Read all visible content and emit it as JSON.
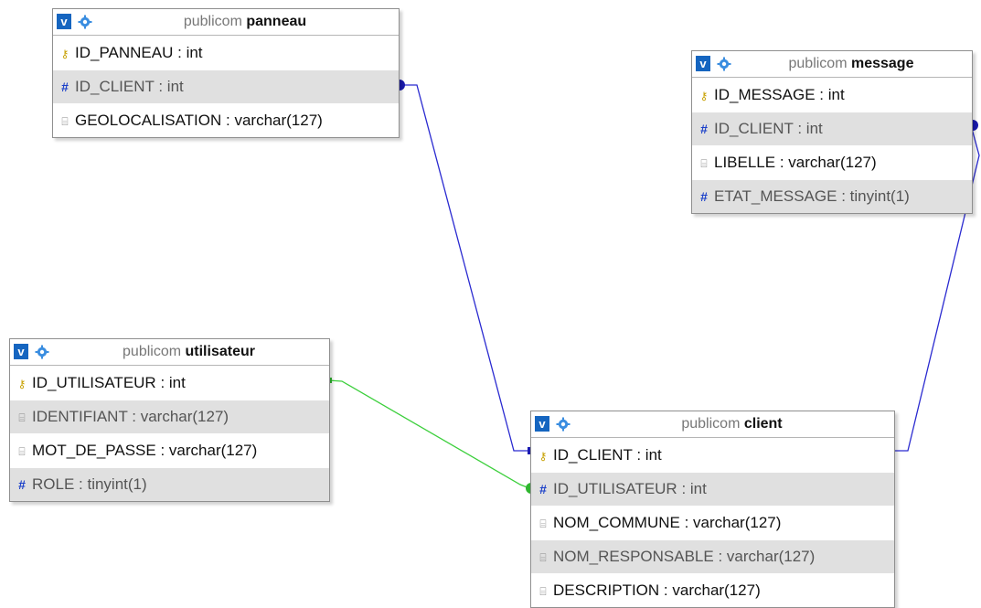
{
  "tables": {
    "panneau": {
      "schema": "publicom",
      "name": "panneau",
      "columns": [
        {
          "name": "ID_PANNEAU",
          "type": ": int",
          "icon": "key-icon"
        },
        {
          "name": "ID_CLIENT",
          "type": ": int",
          "icon": "hash-icon"
        },
        {
          "name": "GEOLOCALISATION",
          "type": ": varchar(127)",
          "icon": "text-icon"
        }
      ]
    },
    "message": {
      "schema": "publicom",
      "name": "message",
      "columns": [
        {
          "name": "ID_MESSAGE",
          "type": ": int",
          "icon": "key-icon"
        },
        {
          "name": "ID_CLIENT",
          "type": ": int",
          "icon": "hash-icon"
        },
        {
          "name": "LIBELLE",
          "type": ": varchar(127)",
          "icon": "text-icon"
        },
        {
          "name": "ETAT_MESSAGE",
          "type": ": tinyint(1)",
          "icon": "hash-icon"
        }
      ]
    },
    "utilisateur": {
      "schema": "publicom",
      "name": "utilisateur",
      "columns": [
        {
          "name": "ID_UTILISATEUR",
          "type": ": int",
          "icon": "key-icon"
        },
        {
          "name": "IDENTIFIANT",
          "type": ": varchar(127)",
          "icon": "text-icon"
        },
        {
          "name": "MOT_DE_PASSE",
          "type": ": varchar(127)",
          "icon": "text-icon"
        },
        {
          "name": "ROLE",
          "type": ": tinyint(1)",
          "icon": "hash-icon"
        }
      ]
    },
    "client": {
      "schema": "publicom",
      "name": "client",
      "columns": [
        {
          "name": "ID_CLIENT",
          "type": ": int",
          "icon": "key-icon"
        },
        {
          "name": "ID_UTILISATEUR",
          "type": ": int",
          "icon": "hash-icon"
        },
        {
          "name": "NOM_COMMUNE",
          "type": ": varchar(127)",
          "icon": "text-icon"
        },
        {
          "name": "NOM_RESPONSABLE",
          "type": ": varchar(127)",
          "icon": "text-icon"
        },
        {
          "name": "DESCRIPTION",
          "type": ": varchar(127)",
          "icon": "text-icon"
        }
      ]
    }
  },
  "toggle_label": "v",
  "colors": {
    "link_blue": "#2a2ad0",
    "link_green": "#3ccf3c",
    "header_button": "#1565c0",
    "alt_row": "#e0e0e0"
  }
}
